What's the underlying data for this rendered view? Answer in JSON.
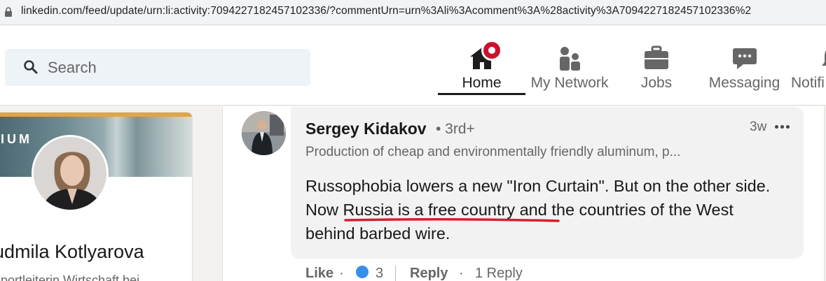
{
  "browser": {
    "url": "linkedin.com/feed/update/urn:li:activity:7094227182457102336/?commentUrn=urn%3Ali%3Acomment%3A%28activity%3A7094227182457102336%2"
  },
  "nav": {
    "search_placeholder": "Search",
    "items": [
      {
        "label": "Home"
      },
      {
        "label": "My Network"
      },
      {
        "label": "Jobs"
      },
      {
        "label": "Messaging"
      },
      {
        "label": "Notifi"
      }
    ]
  },
  "profile": {
    "banner_text": "IUM",
    "name": "udmila Kotlyarova",
    "title": "eportleiterin Wirtschaft bei"
  },
  "comment": {
    "author": "Sergey Kidakov",
    "degree": "• 3rd+",
    "headline": "Production of cheap and environmentally friendly aluminum, p...",
    "time": "3w",
    "text": "Russophobia lowers a new \"Iron Curtain\". But on the other side. Now Russia is a free country and the countries of the West behind barbed wire.",
    "actions": {
      "like": "Like",
      "dot": "·",
      "reaction_count": "3",
      "reply": "Reply",
      "replies": "1 Reply"
    }
  },
  "colors": {
    "notification_badge": "#cb112d",
    "premium_gold": "#e7a33e",
    "underline_annotation": "#d1202f",
    "reaction_blue": "#378fe9"
  }
}
